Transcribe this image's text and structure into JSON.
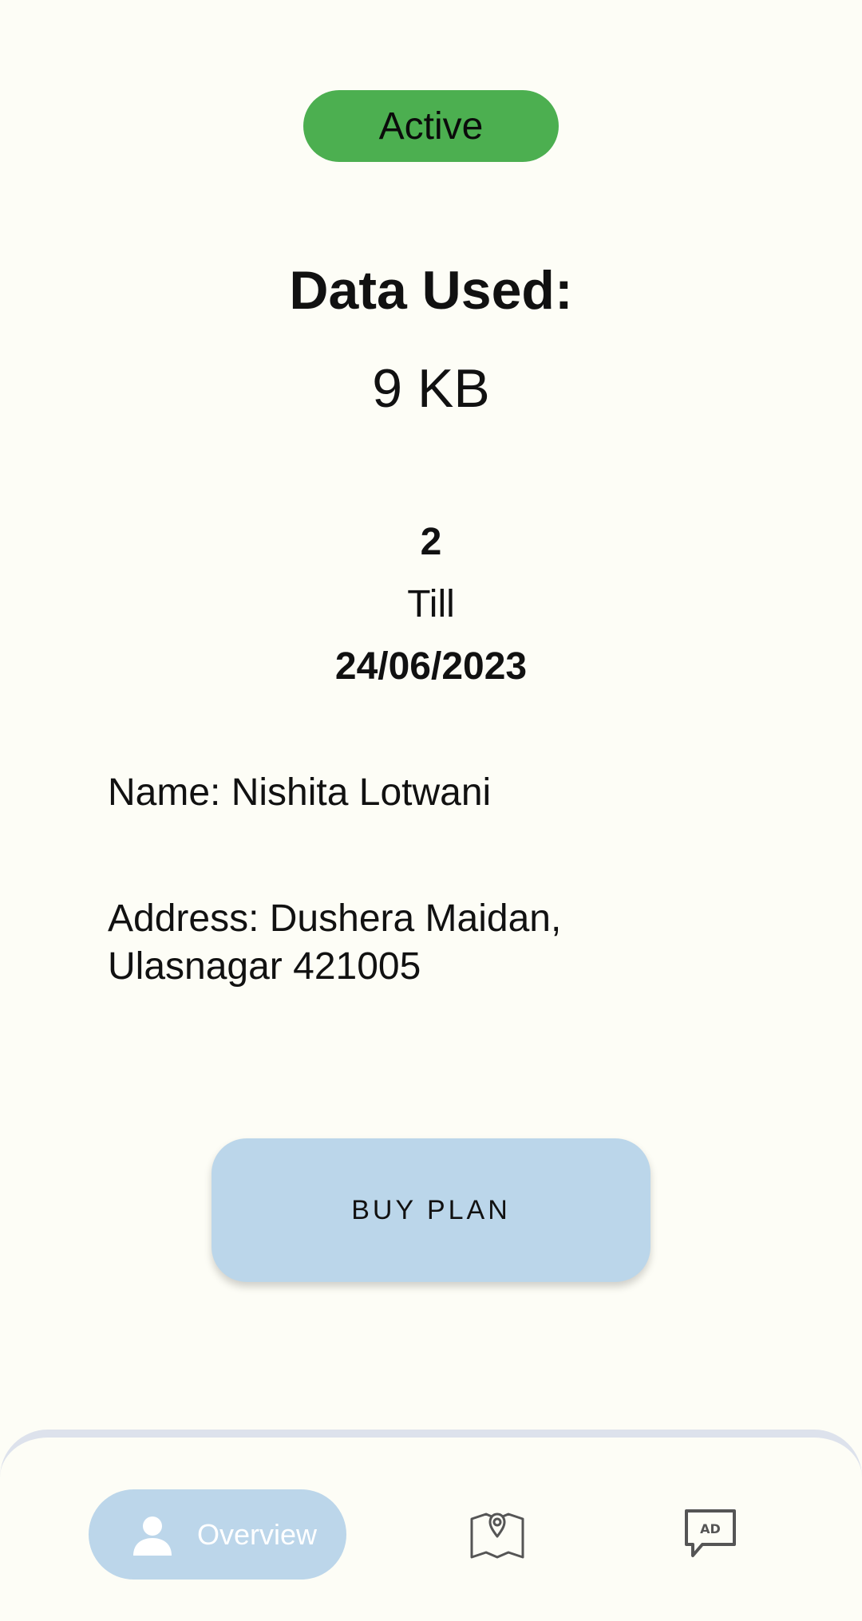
{
  "status": {
    "label": "Active",
    "color": "#4caf50"
  },
  "usage": {
    "title": "Data Used:",
    "value": "9 KB"
  },
  "plan": {
    "number": "2",
    "till_label": "Till",
    "till_date": "24/06/2023"
  },
  "user": {
    "name_line": "Name: Nishita Lotwani",
    "address_line": "Address: Dushera Maidan, Ulasnagar 421005"
  },
  "actions": {
    "buy_plan_label": "BUY PLAN"
  },
  "bottom_nav": {
    "items": [
      {
        "label": "Overview",
        "icon": "person-icon",
        "active": true
      },
      {
        "label": "",
        "icon": "map-pin-icon",
        "active": false
      },
      {
        "label": "",
        "icon": "ad-chat-icon",
        "active": false
      }
    ]
  },
  "colors": {
    "background": "#fdfdf6",
    "accent_light_blue": "#bbd6ea"
  }
}
